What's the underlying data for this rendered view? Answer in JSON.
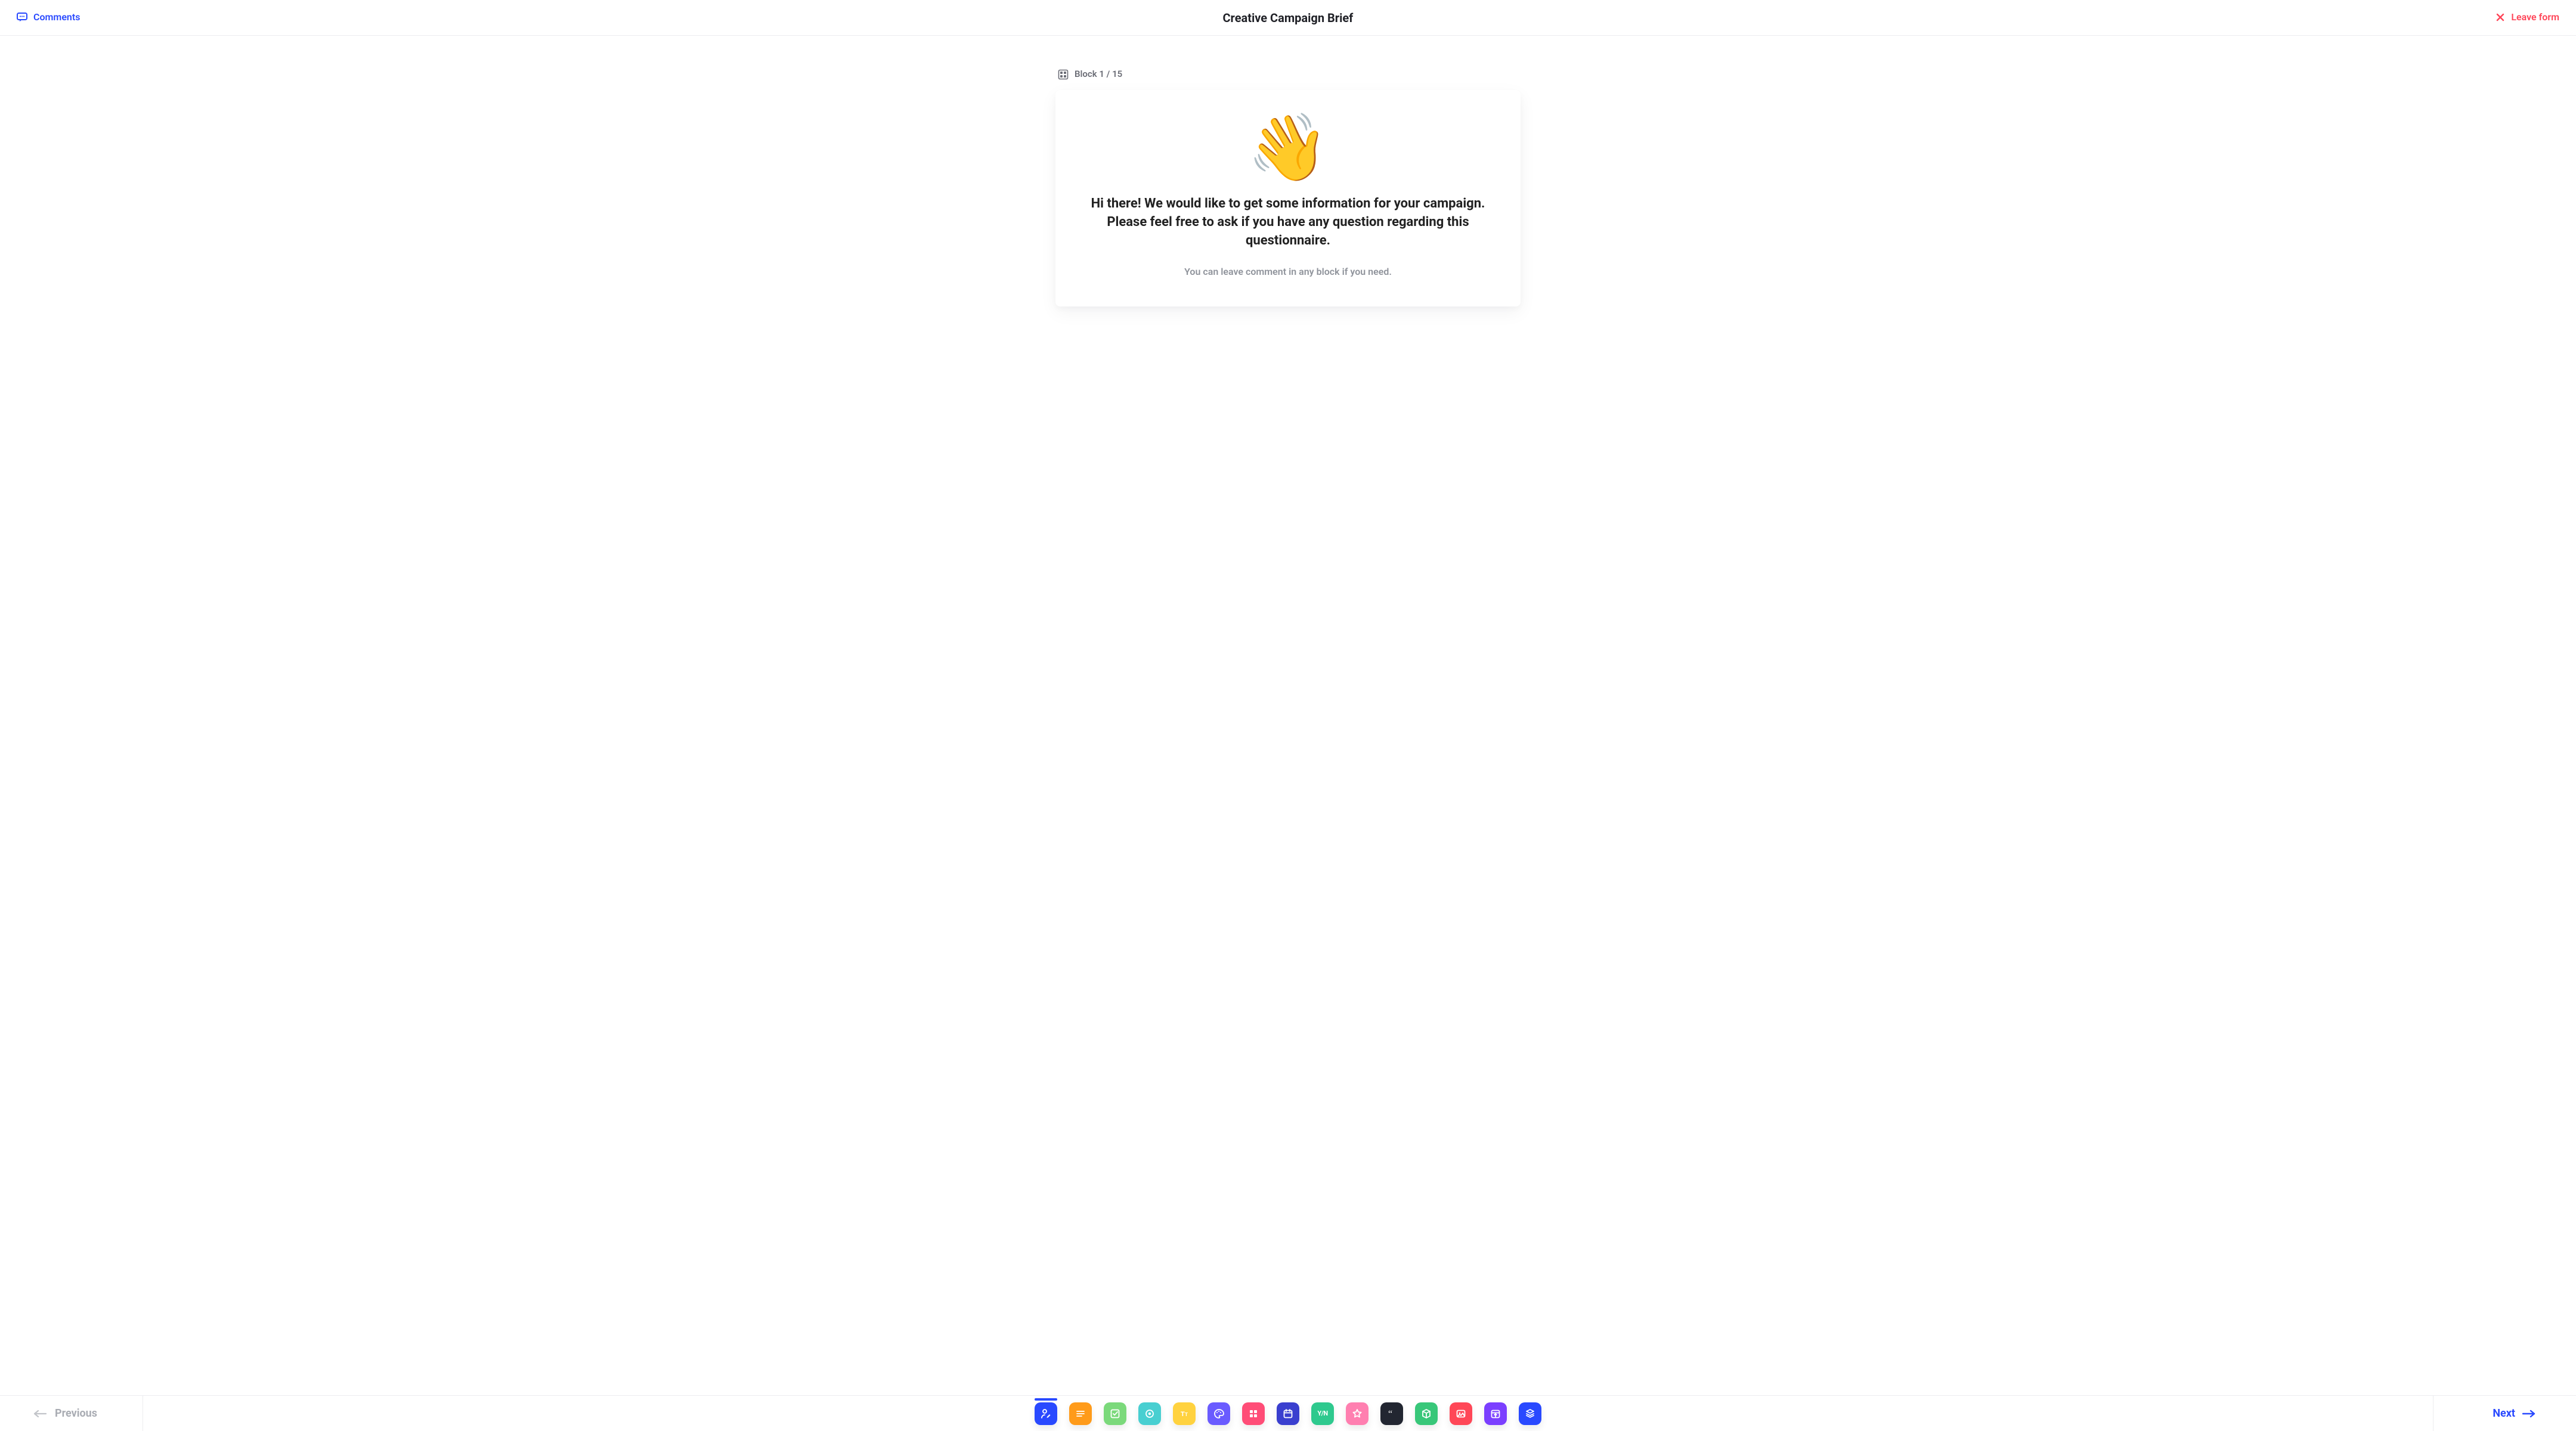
{
  "header": {
    "comments_label": "Comments",
    "title": "Creative Campaign Brief",
    "leave_label": "Leave form"
  },
  "progress": {
    "label_prefix": "Block",
    "current": 1,
    "total": 15,
    "label": "Block 1 / 15"
  },
  "card": {
    "heading": "Hi there! We would like to get some information for your campaign. Please feel free to ask if you have any question regarding this questionnaire.",
    "sub": "You can leave comment in any block if you need."
  },
  "nav": {
    "previous_label": "Previous",
    "next_label": "Next"
  },
  "block_types": [
    {
      "name": "welcome",
      "color": "#2949ff",
      "icon": "user-writing"
    },
    {
      "name": "short-text",
      "color": "#ff9b1a",
      "icon": "lines"
    },
    {
      "name": "checkbox",
      "color": "#7bd97b",
      "icon": "checkbox"
    },
    {
      "name": "target",
      "color": "#48cfd1",
      "icon": "target"
    },
    {
      "name": "text-type",
      "color": "#ffd23f",
      "icon": "tt"
    },
    {
      "name": "palette",
      "color": "#6a5bff",
      "icon": "palette"
    },
    {
      "name": "grid-choice",
      "color": "#ff4d77",
      "icon": "grid4"
    },
    {
      "name": "date",
      "color": "#3a3fcf",
      "icon": "calendar"
    },
    {
      "name": "yes-no",
      "color": "#2ec98e",
      "icon": "yn",
      "label": "Y/N"
    },
    {
      "name": "rating-star",
      "color": "#ff7fb0",
      "icon": "star"
    },
    {
      "name": "quote",
      "color": "#222631",
      "icon": "quote"
    },
    {
      "name": "package",
      "color": "#38c779",
      "icon": "box"
    },
    {
      "name": "image",
      "color": "#ff4757",
      "icon": "image"
    },
    {
      "name": "upload",
      "color": "#7b3fff",
      "icon": "upload-cal"
    },
    {
      "name": "signature",
      "color": "#2949ff",
      "icon": "stack"
    }
  ],
  "colors": {
    "blue": "#2949ff",
    "red": "#ff4457",
    "muted": "#a9acb3"
  }
}
